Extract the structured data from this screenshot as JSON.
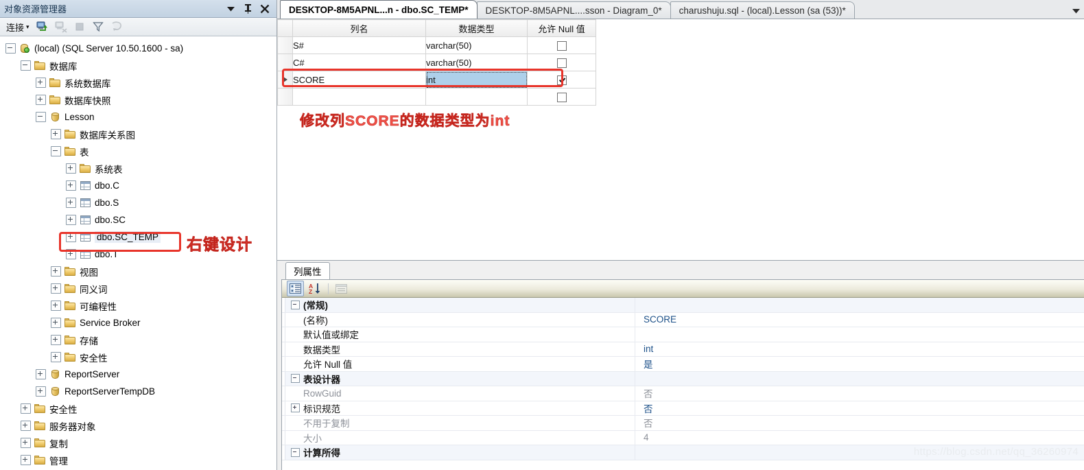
{
  "object_explorer": {
    "title": "对象资源管理器",
    "title_buttons": [
      {
        "name": "window-menu-icon",
        "glyph": "▼"
      },
      {
        "name": "pin-icon",
        "glyph": "pin"
      },
      {
        "name": "close-icon",
        "glyph": "✕"
      }
    ],
    "toolbar": {
      "connect_label": "连接",
      "connect_caret": "▾",
      "icons": [
        {
          "name": "connect-icon",
          "enabled": true
        },
        {
          "name": "disconnect-icon",
          "enabled": false
        },
        {
          "name": "stop-icon",
          "enabled": false
        },
        {
          "name": "filter-icon",
          "enabled": true
        },
        {
          "name": "refresh-icon",
          "enabled": false
        }
      ]
    },
    "tree": [
      {
        "label": "(local) (SQL Server 10.50.1600 - sa)",
        "depth": 0,
        "state": "minus",
        "icon": "server-icon"
      },
      {
        "label": "数据库",
        "depth": 1,
        "state": "minus",
        "icon": "folder-icon"
      },
      {
        "label": "系统数据库",
        "depth": 2,
        "state": "plus",
        "icon": "folder-icon"
      },
      {
        "label": "数据库快照",
        "depth": 2,
        "state": "plus",
        "icon": "folder-icon"
      },
      {
        "label": "Lesson",
        "depth": 2,
        "state": "minus",
        "icon": "database-icon"
      },
      {
        "label": "数据库关系图",
        "depth": 3,
        "state": "plus",
        "icon": "folder-icon"
      },
      {
        "label": "表",
        "depth": 3,
        "state": "minus",
        "icon": "folder-icon"
      },
      {
        "label": "系统表",
        "depth": 4,
        "state": "plus",
        "icon": "folder-icon"
      },
      {
        "label": "dbo.C",
        "depth": 4,
        "state": "plus",
        "icon": "table-icon"
      },
      {
        "label": "dbo.S",
        "depth": 4,
        "state": "plus",
        "icon": "table-icon"
      },
      {
        "label": "dbo.SC",
        "depth": 4,
        "state": "plus",
        "icon": "table-icon"
      },
      {
        "label": "dbo.SC_TEMP",
        "depth": 4,
        "state": "plus",
        "icon": "table-icon",
        "selected": true
      },
      {
        "label": "dbo.T",
        "depth": 4,
        "state": "plus",
        "icon": "table-icon"
      },
      {
        "label": "视图",
        "depth": 3,
        "state": "plus",
        "icon": "folder-icon"
      },
      {
        "label": "同义词",
        "depth": 3,
        "state": "plus",
        "icon": "folder-icon"
      },
      {
        "label": "可编程性",
        "depth": 3,
        "state": "plus",
        "icon": "folder-icon"
      },
      {
        "label": "Service Broker",
        "depth": 3,
        "state": "plus",
        "icon": "folder-icon"
      },
      {
        "label": "存储",
        "depth": 3,
        "state": "plus",
        "icon": "folder-icon"
      },
      {
        "label": "安全性",
        "depth": 3,
        "state": "plus",
        "icon": "folder-icon"
      },
      {
        "label": "ReportServer",
        "depth": 2,
        "state": "plus",
        "icon": "database-icon"
      },
      {
        "label": "ReportServerTempDB",
        "depth": 2,
        "state": "plus",
        "icon": "database-icon"
      },
      {
        "label": "安全性",
        "depth": 1,
        "state": "plus",
        "icon": "folder-icon"
      },
      {
        "label": "服务器对象",
        "depth": 1,
        "state": "plus",
        "icon": "folder-icon"
      },
      {
        "label": "复制",
        "depth": 1,
        "state": "plus",
        "icon": "folder-icon"
      },
      {
        "label": "管理",
        "depth": 1,
        "state": "plus",
        "icon": "folder-icon"
      }
    ]
  },
  "tabs": [
    {
      "label": "DESKTOP-8M5APNL...n - dbo.SC_TEMP*",
      "active": true
    },
    {
      "label": "DESKTOP-8M5APNL....sson - Diagram_0*",
      "active": false
    },
    {
      "label": "charushuju.sql - (local).Lesson (sa (53))*",
      "active": false
    }
  ],
  "tab_overflow_glyph": "▼",
  "designer": {
    "columns": [
      "列名",
      "数据类型",
      "允许 Null 值"
    ],
    "rows": [
      {
        "name": "S#",
        "datatype": "varchar(50)",
        "allow_null": false,
        "current": false
      },
      {
        "name": "C#",
        "datatype": "varchar(50)",
        "allow_null": false,
        "current": false
      },
      {
        "name": "SCORE",
        "datatype": "int",
        "allow_null": true,
        "current": true,
        "selected_cell": "datatype"
      },
      {
        "name": "",
        "datatype": "",
        "allow_null": false,
        "current": false
      }
    ]
  },
  "annotations": [
    {
      "name": "annotation-right-click-design",
      "text": "右键设计",
      "color": "#f2534a"
    },
    {
      "name": "annotation-change-score-type",
      "text": "修改列SCORE的数据类型为int",
      "color": "#f2534a"
    }
  ],
  "properties_pane": {
    "tab_label": "列属性",
    "toolbar_icons": [
      {
        "name": "categorized-view-icon",
        "pressed": true,
        "enabled": true
      },
      {
        "name": "alphabetical-sort-icon",
        "pressed": false,
        "enabled": true
      },
      {
        "name": "property-pages-icon",
        "pressed": false,
        "enabled": false
      }
    ],
    "groups": [
      {
        "name": "(常规)",
        "state": "minus",
        "value": "",
        "rows": [
          {
            "name": "(名称)",
            "value": "SCORE",
            "state": "blank",
            "dim": false
          },
          {
            "name": "默认值或绑定",
            "value": "",
            "state": "blank",
            "dim": false
          },
          {
            "name": "数据类型",
            "value": "int",
            "state": "blank",
            "dim": false
          },
          {
            "name": "允许 Null 值",
            "value": "是",
            "state": "blank",
            "dim": false
          }
        ]
      },
      {
        "name": "表设计器",
        "state": "minus",
        "value": "",
        "rows": [
          {
            "name": "RowGuid",
            "value": "否",
            "state": "blank",
            "dim": true
          },
          {
            "name": "标识规范",
            "value": "否",
            "state": "plus",
            "dim": false
          },
          {
            "name": "不用于复制",
            "value": "否",
            "state": "blank",
            "dim": true
          },
          {
            "name": "大小",
            "value": "4",
            "state": "blank",
            "dim": true
          }
        ]
      },
      {
        "name": "计算所得",
        "state": "minus",
        "value": "",
        "rows": []
      }
    ]
  },
  "watermark": "https://blog.csdn.net/qq_36260974",
  "colors": {
    "accent_selection": "#aed0ea",
    "annotation_red": "#f2534a",
    "panel_title": "#c2d2e2",
    "property_value": "#1b4f88"
  }
}
